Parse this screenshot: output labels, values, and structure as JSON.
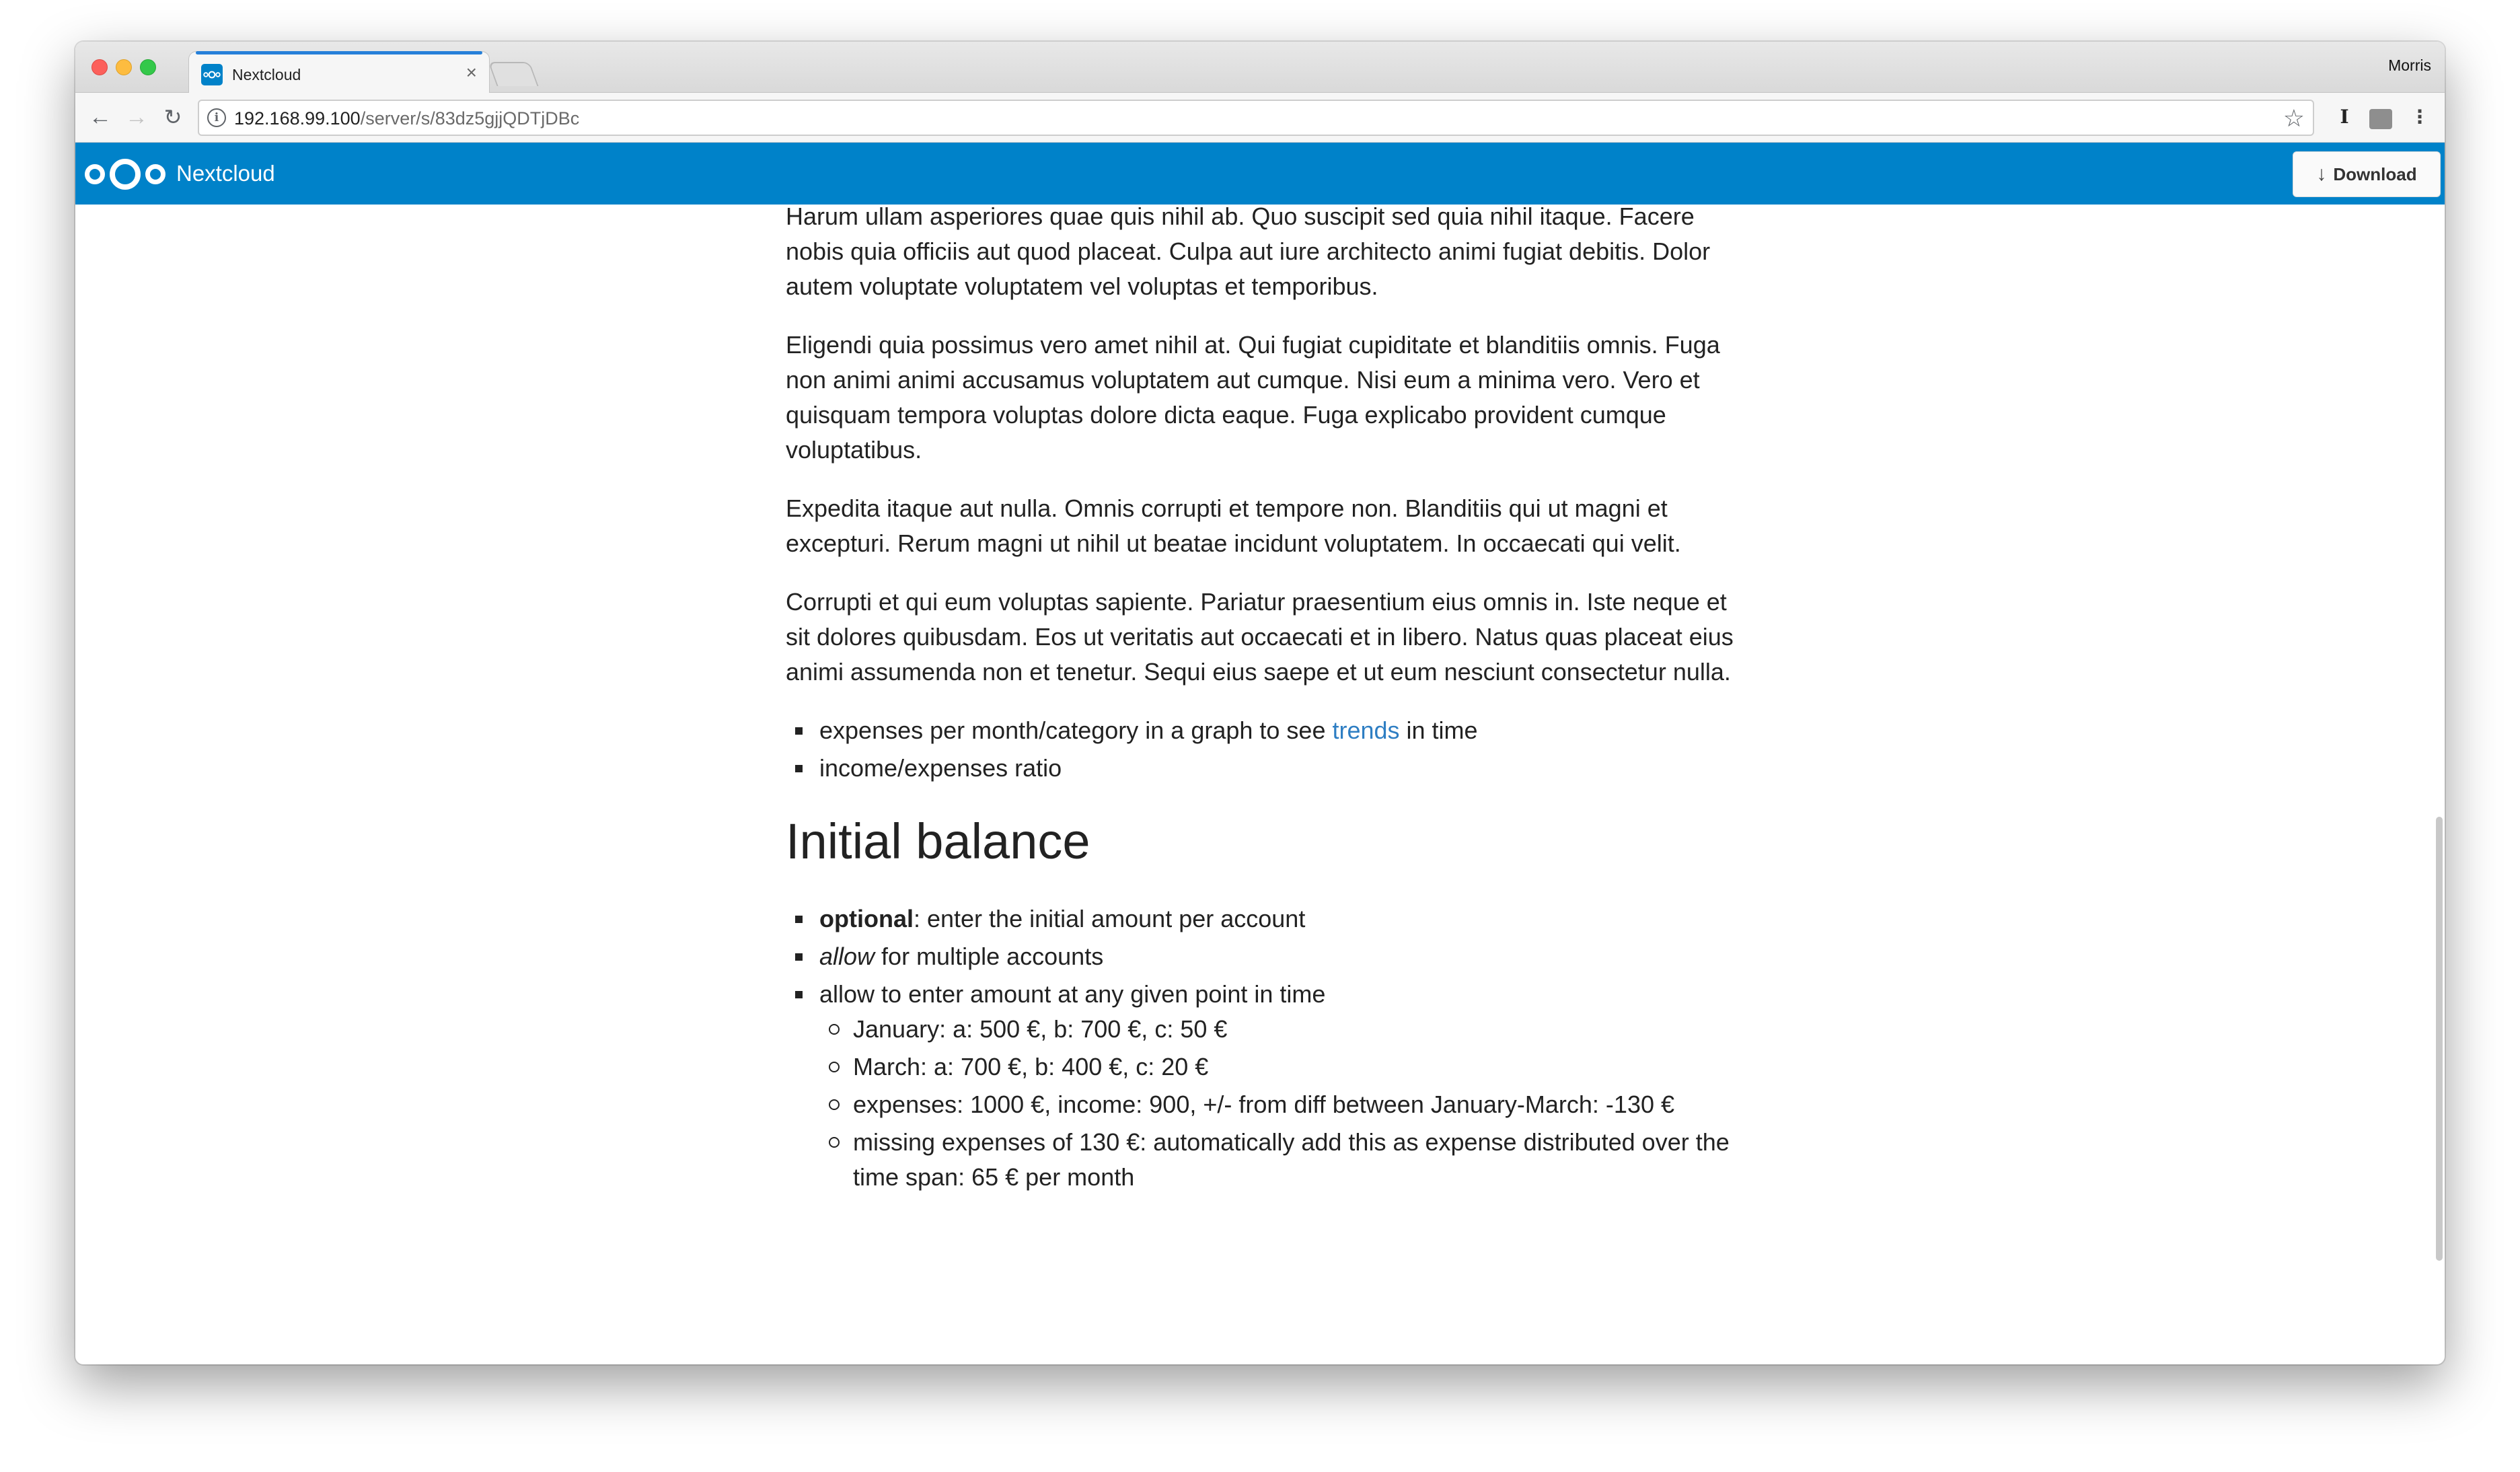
{
  "browser": {
    "tab": {
      "title": "Nextcloud",
      "close_glyph": "×",
      "favicon": "nextcloud-logo-icon"
    },
    "profile_name": "Morris",
    "url": {
      "host": "192.168.99.100",
      "path": "/server/s/83dz5gjjQDTjDBc"
    },
    "icons": {
      "back": "←",
      "forward": "→",
      "reload": "↻",
      "info": "i",
      "star": "☆",
      "ext1": "I",
      "menu": "⋮"
    },
    "colors": {
      "tab_accent": "#2680d9",
      "close_red": "#fc605b",
      "minimize_yellow": "#fdbc40",
      "zoom_green": "#34c84a"
    }
  },
  "header": {
    "app_name": "Nextcloud",
    "download_label": "Download",
    "download_icon": "↓",
    "brand_color": "#0082c9"
  },
  "content": {
    "paragraphs": [
      "Harum ullam asperiores quae quis nihil ab. Quo suscipit sed quia nihil itaque. Facere nobis quia officiis aut quod placeat. Culpa aut iure architecto animi fugiat debitis. Dolor autem voluptate voluptatem vel voluptas et temporibus.",
      "Eligendi quia possimus vero amet nihil at. Qui fugiat cupiditate et blanditiis omnis. Fuga non animi animi accusamus voluptatem aut cumque. Nisi eum a minima vero. Vero et quisquam tempora voluptas dolore dicta eaque. Fuga explicabo provident cumque voluptatibus.",
      "Expedita itaque aut nulla. Omnis corrupti et tempore non. Blanditiis qui ut magni et excepturi. Rerum magni ut nihil ut beatae incidunt voluptatem. In occaecati qui velit.",
      "Corrupti et qui eum voluptas sapiente. Pariatur praesentium eius omnis in. Iste neque et sit dolores quibusdam. Eos ut veritatis aut occaecati et in libero. Natus quas placeat eius animi assumenda non et tenetur. Sequi eius saepe et ut eum nesciunt consectetur nulla."
    ],
    "list1": {
      "item1_before": "expenses per month/category in a graph to see ",
      "item1_link": "trends",
      "item1_after": " in time",
      "item2": "income/expenses ratio"
    },
    "heading": "Initial balance",
    "list2": {
      "item1_bold": "optional",
      "item1_rest": ": enter the initial amount per account",
      "item2_italic": "allow",
      "item2_rest": " for multiple accounts",
      "item3": "allow to enter amount at any given point in time",
      "sub": [
        "January: a: 500 €, b: 700 €, c: 50 €",
        "March: a: 700 €, b: 400 €, c: 20 €",
        "expenses: 1000 €, income: 900, +/- from diff between January-March: -130 €",
        "missing expenses of 130 €: automatically add this as expense distributed over the time span: 65 € per month"
      ]
    },
    "link_color": "#2e7ec3"
  }
}
